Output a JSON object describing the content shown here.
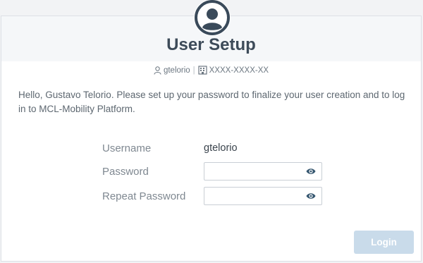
{
  "header": {
    "title": "User Setup",
    "username": "gtelorio",
    "separator": "|",
    "id_value": "XXXX-XXXX-XX"
  },
  "intro": {
    "text": "Hello, Gustavo Telorio. Please set up your password to finalize your user creation and to log in to MCL-Mobility Platform."
  },
  "form": {
    "username_label": "Username",
    "username_value": "gtelorio",
    "password_label": "Password",
    "password_value": "",
    "repeat_password_label": "Repeat Password",
    "repeat_password_value": ""
  },
  "actions": {
    "login_label": "Login"
  },
  "icons": {
    "avatar": "user-circle-icon",
    "user": "user-outline-icon",
    "id": "building-icon",
    "eye": "eye-icon"
  },
  "colors": {
    "title": "#3d4b59",
    "accent": "#35566f",
    "login_disabled": "#c9dbea"
  }
}
